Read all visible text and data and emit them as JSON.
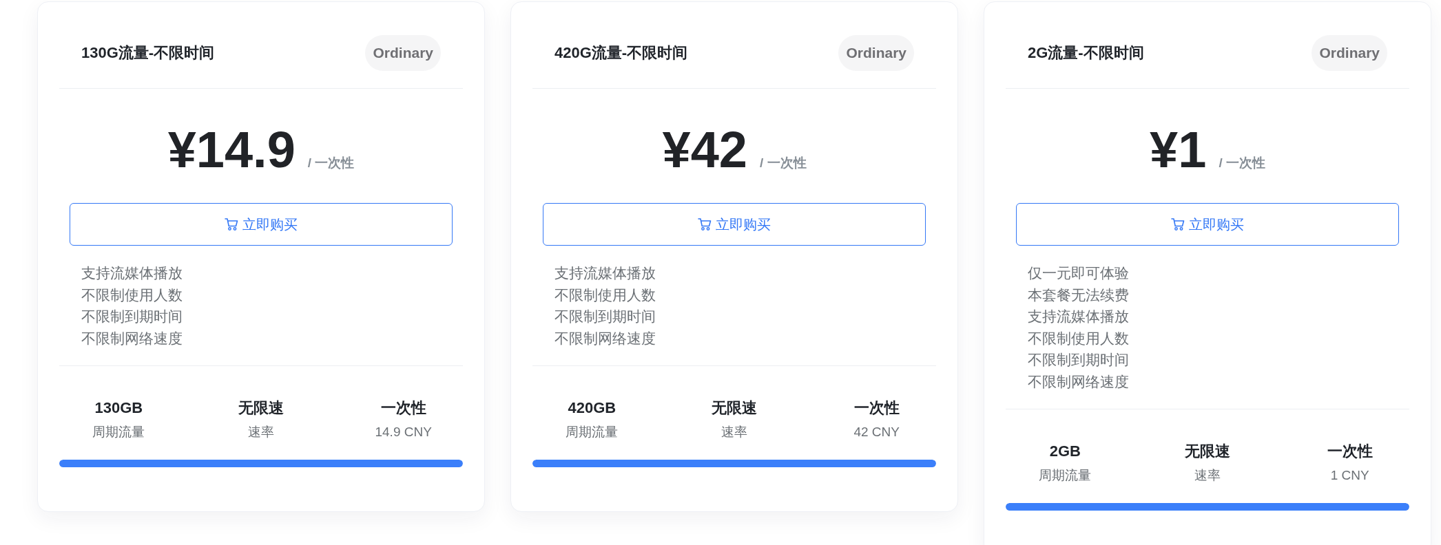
{
  "plans": [
    {
      "title": "130G流量-不限时间",
      "badge": "Ordinary",
      "price": "¥14.9",
      "period": "/ 一次性",
      "buy_button": "立即购买",
      "features": [
        "支持流媒体播放",
        "不限制使用人数",
        "不限制到期时间",
        "不限制网络速度"
      ],
      "stats": [
        {
          "value": "130GB",
          "label": "周期流量"
        },
        {
          "value": "无限速",
          "label": "速率"
        },
        {
          "value": "一次性",
          "label": "14.9 CNY"
        }
      ],
      "level": 1
    },
    {
      "title": "420G流量-不限时间",
      "badge": "Ordinary",
      "price": "¥42",
      "period": "/ 一次性",
      "buy_button": "立即购买",
      "features": [
        "支持流媒体播放",
        "不限制使用人数",
        "不限制到期时间",
        "不限制网络速度"
      ],
      "stats": [
        {
          "value": "420GB",
          "label": "周期流量"
        },
        {
          "value": "无限速",
          "label": "速率"
        },
        {
          "value": "一次性",
          "label": "42 CNY"
        }
      ],
      "level": 1
    },
    {
      "title": "2G流量-不限时间",
      "badge": "Ordinary",
      "price": "¥1",
      "period": "/ 一次性",
      "buy_button": "立即购买",
      "features": [
        "仅一元即可体验",
        "本套餐无法续费",
        "支持流媒体播放",
        "不限制使用人数",
        "不限制到期时间",
        "不限制网络速度"
      ],
      "stats": [
        {
          "value": "2GB",
          "label": "周期流量"
        },
        {
          "value": "无限速",
          "label": "速率"
        },
        {
          "value": "一次性",
          "label": "1 CNY"
        }
      ],
      "level": 1
    }
  ]
}
